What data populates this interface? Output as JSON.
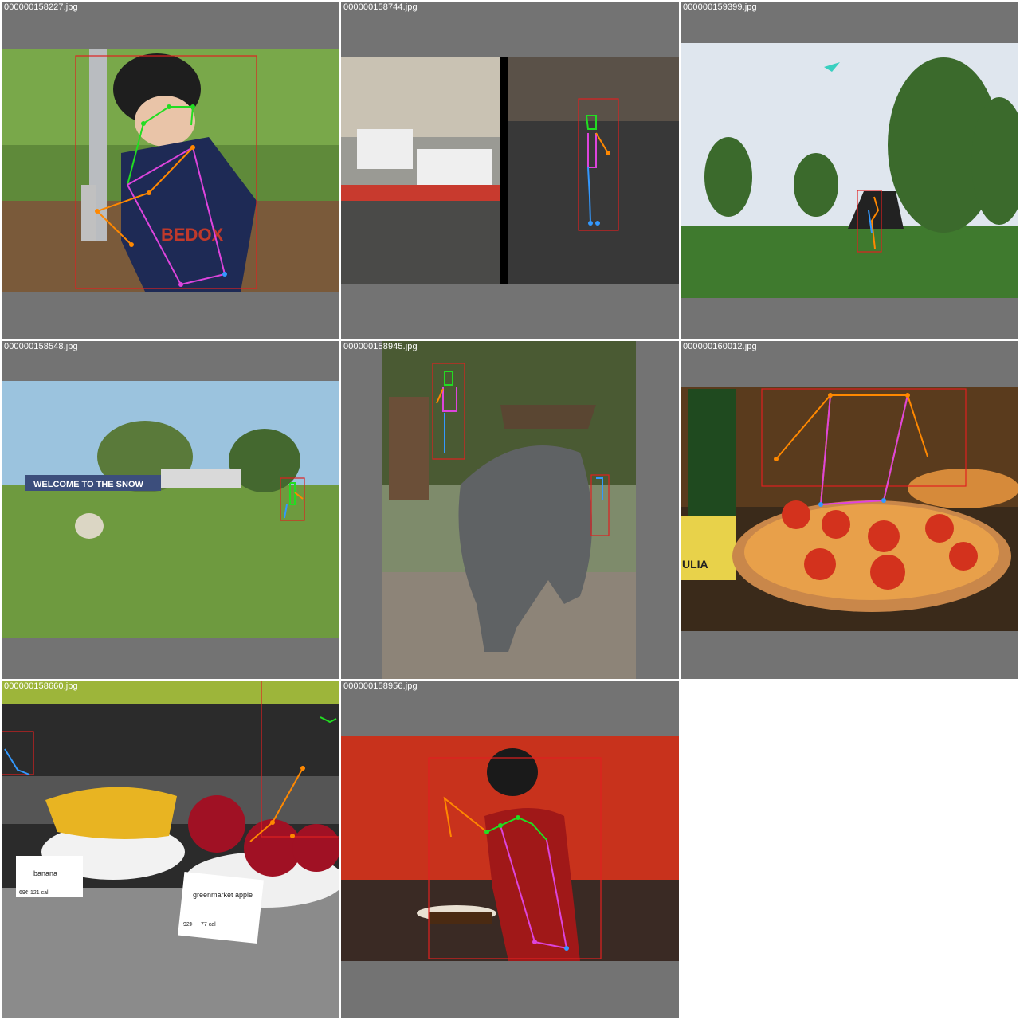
{
  "tiles": [
    {
      "filename": "000000158227.jpg",
      "jersey_text": "BEDOX"
    },
    {
      "filename": "000000158744.jpg"
    },
    {
      "filename": "000000159399.jpg"
    },
    {
      "filename": "000000158548.jpg",
      "banner_text": "WELCOME TO THE SNOW"
    },
    {
      "filename": "000000158945.jpg"
    },
    {
      "filename": "000000160012.jpg",
      "bottle_text": "ULIA"
    },
    {
      "filename": "000000158660.jpg",
      "sign_banana": {
        "name": "banana",
        "price": "69¢",
        "cal": "121 cal"
      },
      "sign_apple": {
        "name": "greenmarket apple",
        "price": "92¢",
        "cal": "77 cal"
      }
    },
    {
      "filename": "000000158956.jpg"
    }
  ],
  "colors": {
    "tile_bg": "#737373",
    "bbox": "#e02020",
    "skeleton_head": "#22dd22",
    "skeleton_torso": "#dd44dd",
    "skeleton_left": "#ff8800",
    "skeleton_right": "#3399ff"
  }
}
